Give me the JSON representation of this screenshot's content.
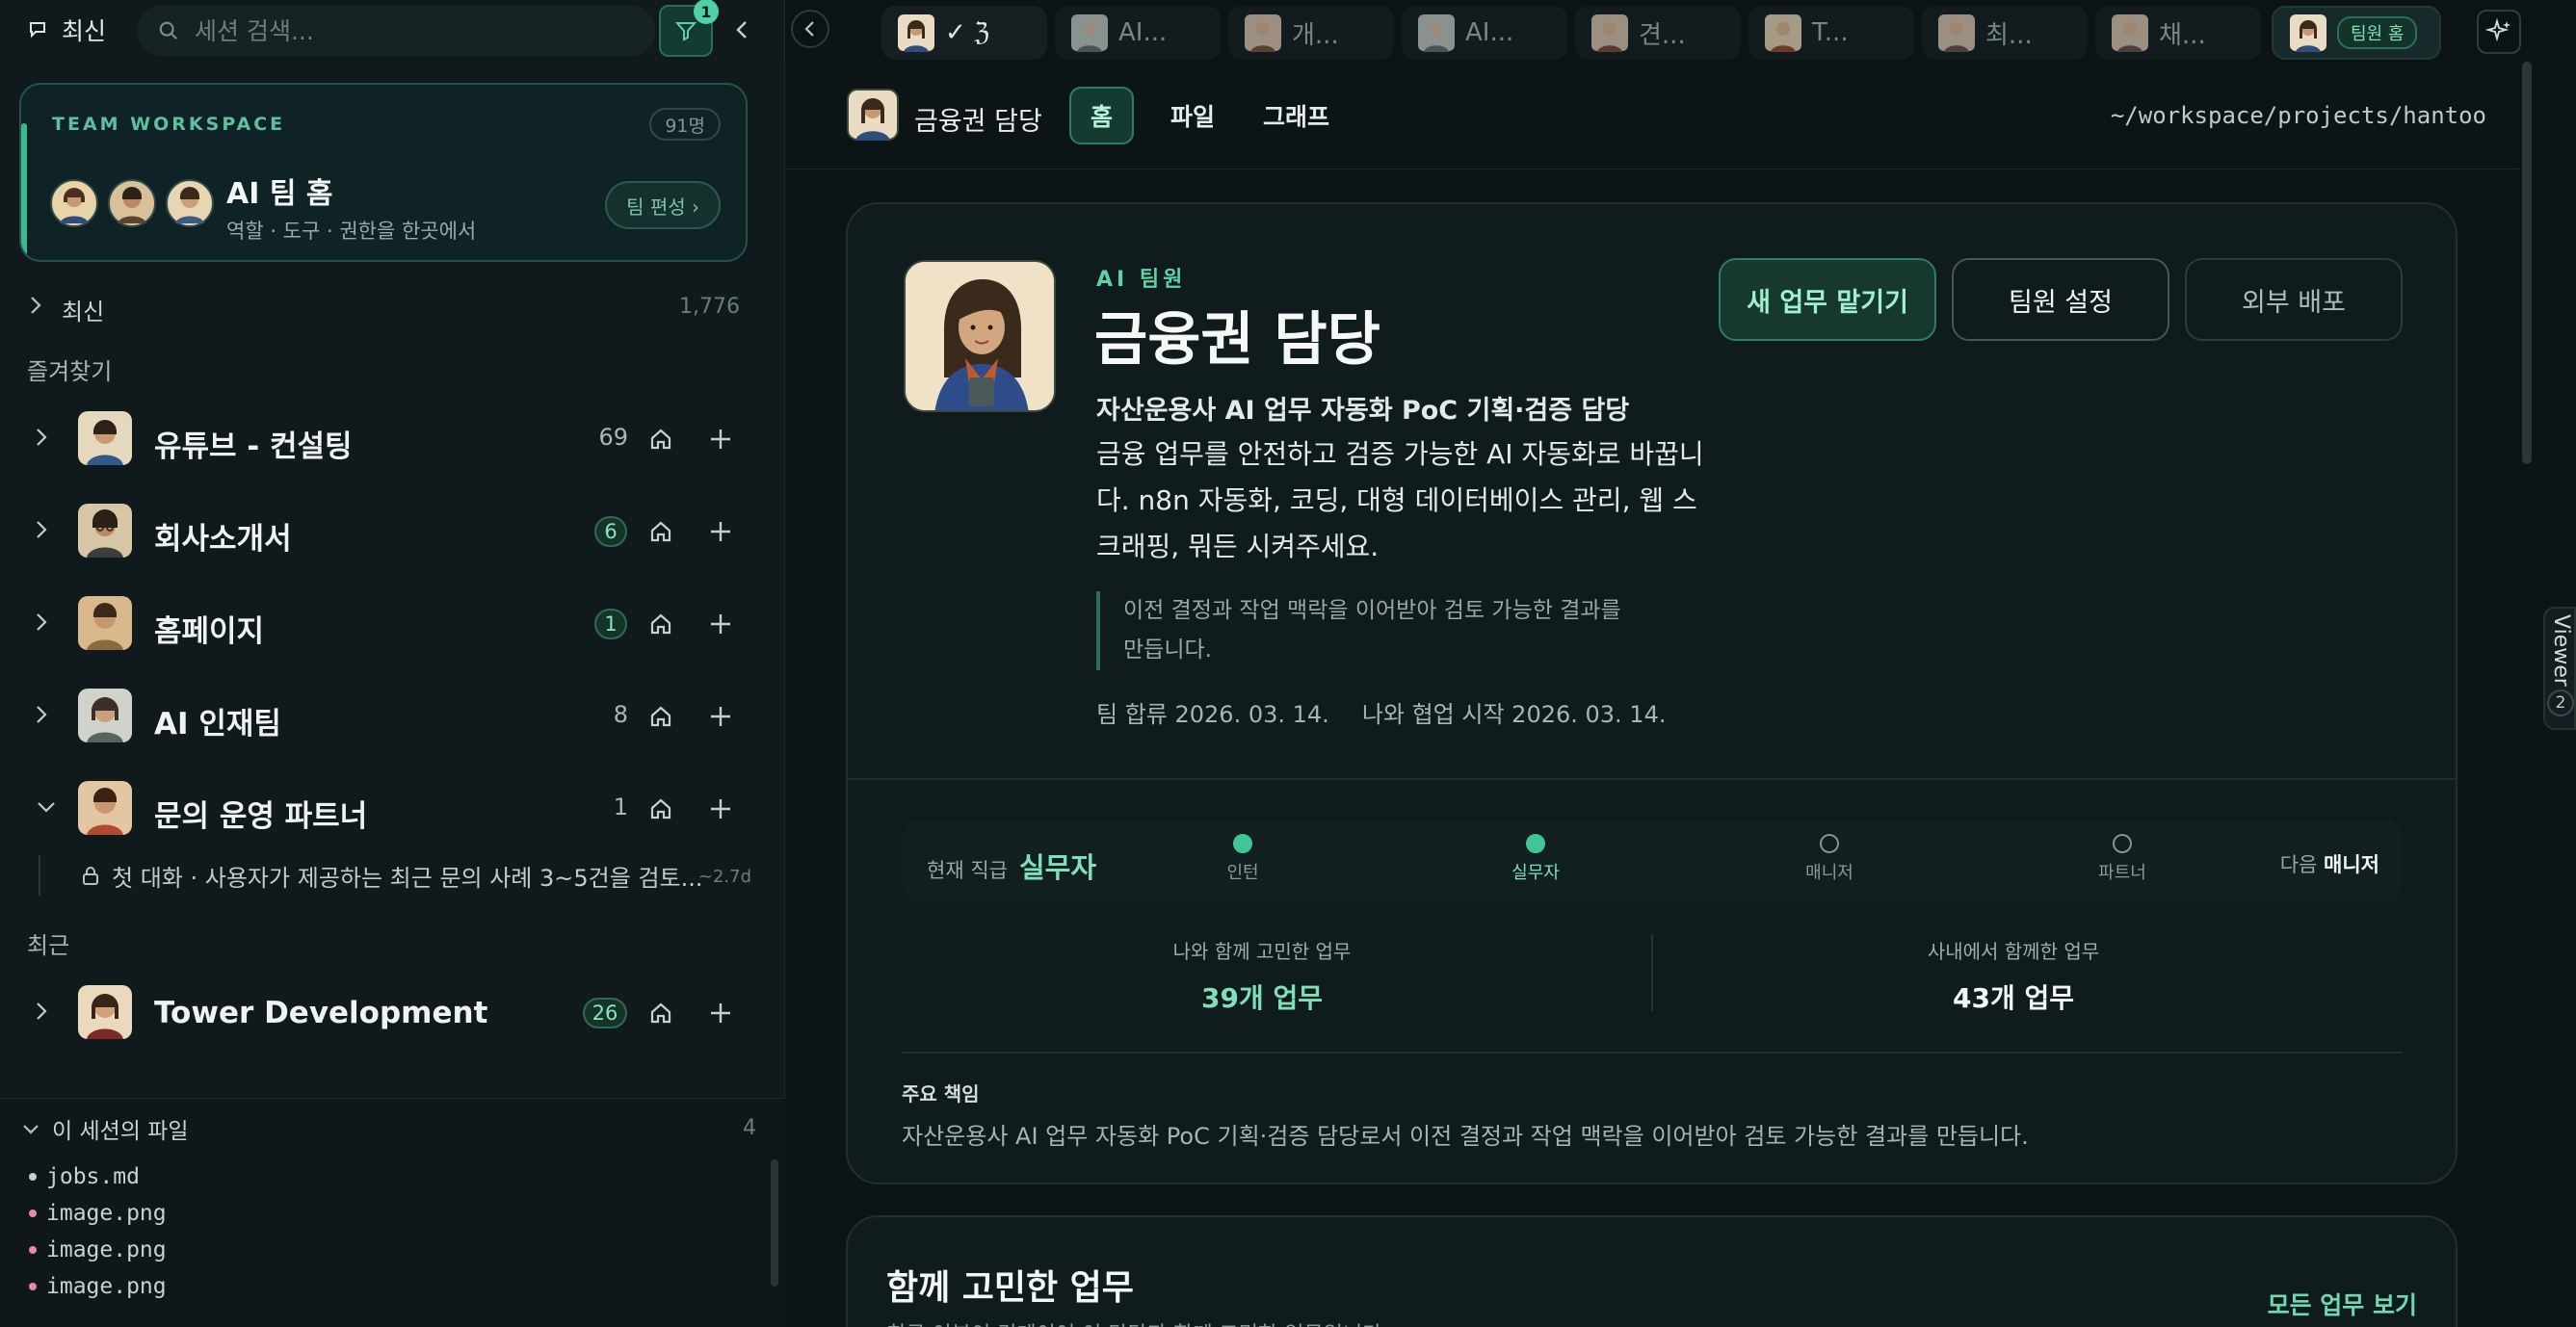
{
  "sidebar": {
    "recent_label": "최신",
    "search_placeholder": "세션 검색...",
    "filter_badge": "1",
    "team": {
      "kicker": "TEAM WORKSPACE",
      "count": "91명",
      "title": "AI 팀 홈",
      "subtitle": "역할 · 도구 · 권한을 한곳에서",
      "edit_label": "팀 편성 ›"
    },
    "recent_section": {
      "label": "최신",
      "count": "1,776"
    },
    "favorites_heading": "즐겨찾기",
    "favorites": [
      {
        "name": "유튜브 - 컨설팅",
        "count": "69",
        "pill": false,
        "expanded": false
      },
      {
        "name": "회사소개서",
        "count": "6",
        "pill": true,
        "expanded": false
      },
      {
        "name": "홈페이지",
        "count": "1",
        "pill": true,
        "expanded": false
      },
      {
        "name": "AI 인재팀",
        "count": "8",
        "pill": false,
        "expanded": false
      },
      {
        "name": "문의 운영 파트너",
        "count": "1",
        "pill": false,
        "expanded": true
      }
    ],
    "session": {
      "text": "첫 대화 · 사용자가 제공하는 최근 문의 사례 3~5건을 검토...",
      "age": "~2.7d"
    },
    "recent_heading": "최근",
    "recent_items": [
      {
        "name": "Tower Development",
        "count": "26",
        "pill": true
      }
    ],
    "files": {
      "heading": "이 세션의 파일",
      "count": "4",
      "items": [
        {
          "name": "jobs.md",
          "color": "#c8d2d1"
        },
        {
          "name": "image.png",
          "color": "#e88aa6"
        },
        {
          "name": "image.png",
          "color": "#e88aa6"
        },
        {
          "name": "image.png",
          "color": "#e88aa6"
        }
      ]
    }
  },
  "tabs": [
    {
      "label": "✓ ℨ",
      "state": "first"
    },
    {
      "label": "AI...",
      "state": "normal"
    },
    {
      "label": "개...",
      "state": "normal"
    },
    {
      "label": "AI...",
      "state": "normal"
    },
    {
      "label": "견...",
      "state": "normal"
    },
    {
      "label": "T...",
      "state": "normal"
    },
    {
      "label": "최...",
      "state": "normal"
    },
    {
      "label": "채...",
      "state": "normal"
    },
    {
      "label": "팀원 홈",
      "state": "active"
    }
  ],
  "header": {
    "name": "금융권 담당",
    "tabs": [
      "홈",
      "파일",
      "그래프"
    ],
    "active_tab": 0,
    "path": "~/workspace/projects/hantoo"
  },
  "profile": {
    "kicker": "AI 팀원",
    "name": "금융권 담당",
    "role": "자산운용사 AI 업무 자동화 PoC 기획·검증 담당",
    "description": "금융 업무를 안전하고 검증 가능한 AI 자동화로 바꿉니다. n8n 자동화, 코딩, 대형 데이터베이스 관리, 웹 스크래핑, 뭐든 시켜주세요.",
    "quote": "이전 결정과 작업 맥락을 이어받아 검토 가능한 결과를 만듭니다.",
    "joined": "팀 합류 2026. 03. 14.",
    "collab_start": "나와 협업 시작 2026. 03. 14.",
    "buttons": {
      "primary": "새 업무 맡기기",
      "settings": "팀원 설정",
      "deploy": "외부 배포"
    },
    "level": {
      "current_label": "현재 직급",
      "current": "실무자",
      "steps": [
        {
          "label": "인턴",
          "reached": true
        },
        {
          "label": "실무자",
          "reached": true,
          "current": true
        },
        {
          "label": "매니저",
          "reached": false
        },
        {
          "label": "파트너",
          "reached": false
        }
      ],
      "next_label": "다음",
      "next": "매니저"
    },
    "stats": [
      {
        "label": "나와 함께 고민한 업무",
        "value": "39개 업무",
        "color": "#7de0b9"
      },
      {
        "label": "사내에서 함께한 업무",
        "value": "43개 업무",
        "color": "#f1f5f4"
      }
    ],
    "responsibility_label": "주요 책임",
    "responsibility": "자산운용사 AI 업무 자동화 PoC 기획·검증 담당로서 이전 결정과 작업 맥락을 이어받아 검토 가능한 결과를 만듭니다."
  },
  "tasks": {
    "title": "함께 고민한 업무",
    "subtitle": "최근 이분이 경계이어 이 담당과 함께 고민한 업무입니다.",
    "link": "모든 업무 보기"
  },
  "viewer": {
    "label": "Viewer",
    "count": "2"
  },
  "colors": {
    "accent": "#4fd1a5",
    "background": "#0d1416",
    "sidebar": "#101a1c"
  }
}
